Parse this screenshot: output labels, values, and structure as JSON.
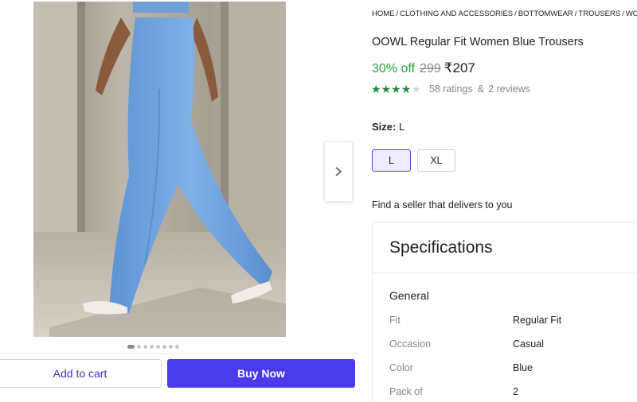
{
  "breadcrumb": [
    "HOME",
    "CLOTHING AND ACCESSORIES",
    "BOTTOMWEAR",
    "TROUSERS",
    "WOMEN'S"
  ],
  "product": {
    "title": "OOWL Regular Fit Women Blue Trousers",
    "discount": "30% off",
    "mrp": "299",
    "price": "₹207",
    "rating_value": 4,
    "rating_max": 5,
    "ratings_text": "58 ratings",
    "reviews_text": "2 reviews"
  },
  "size": {
    "label": "Size:",
    "selected": "L",
    "options": [
      "L",
      "XL"
    ]
  },
  "seller_prompt": "Find a seller that delivers to you",
  "specifications": {
    "title": "Specifications",
    "group": "General",
    "rows": [
      {
        "key": "Fit",
        "value": "Regular Fit"
      },
      {
        "key": "Occasion",
        "value": "Casual"
      },
      {
        "key": "Color",
        "value": "Blue"
      },
      {
        "key": "Pack of",
        "value": "2"
      }
    ]
  },
  "gallery": {
    "dot_count": 8,
    "active_index": 0,
    "icons": {
      "next": "chevron-right-icon"
    }
  },
  "actions": {
    "add_to_cart": "Add to cart",
    "buy_now": "Buy Now"
  },
  "colors": {
    "accent": "#4a3cec",
    "discount_green": "#26a541",
    "star_green": "#1f8b3a"
  }
}
